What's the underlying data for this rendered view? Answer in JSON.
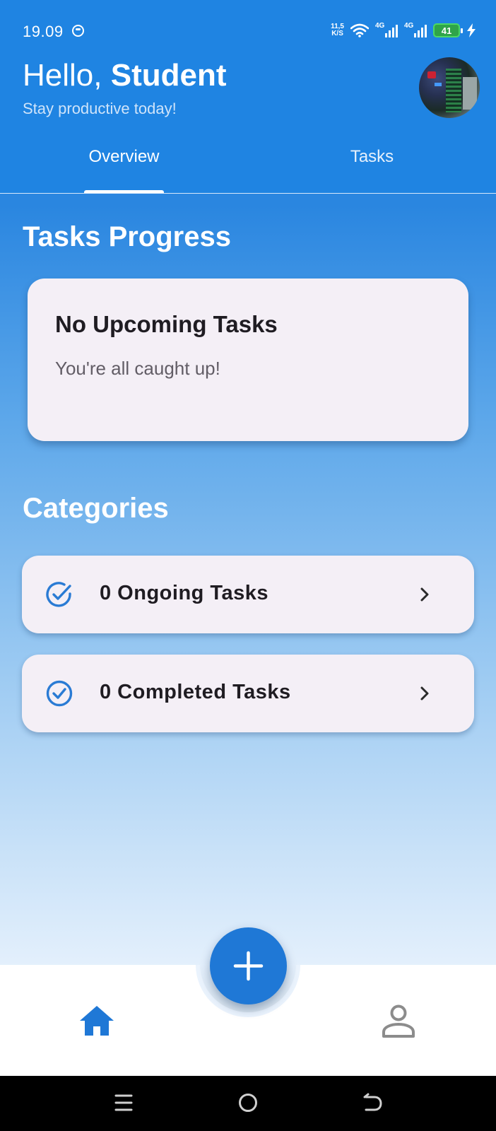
{
  "status_bar": {
    "time": "19.09",
    "speed_top": "11,5",
    "speed_unit": "K/S",
    "signal1_label": "4G",
    "signal2_label": "4G",
    "battery": "41"
  },
  "header": {
    "greeting_prefix": "Hello, ",
    "user_name": "Student",
    "subtitle": "Stay productive today!"
  },
  "tabs": [
    {
      "label": "Overview",
      "selected": true
    },
    {
      "label": "Tasks",
      "selected": false
    }
  ],
  "progress": {
    "section_title": "Tasks Progress",
    "card_title": "No Upcoming Tasks",
    "card_subtitle": "You're all caught up!"
  },
  "categories": {
    "section_title": "Categories",
    "items": [
      {
        "label": "0 Ongoing Tasks",
        "icon": "check-circle-icon"
      },
      {
        "label": "0 Completed Tasks",
        "icon": "check-circle-icon"
      }
    ]
  },
  "bottom_nav": {
    "items": [
      {
        "name": "home",
        "icon": "home-icon",
        "active": true
      },
      {
        "name": "profile",
        "icon": "person-icon",
        "active": false
      }
    ],
    "fab_icon": "plus-icon"
  },
  "colors": {
    "primary": "#1f84e2",
    "fab": "#1f78d6",
    "card_bg": "#f4eff6",
    "icon_blue": "#2a7bd4"
  }
}
